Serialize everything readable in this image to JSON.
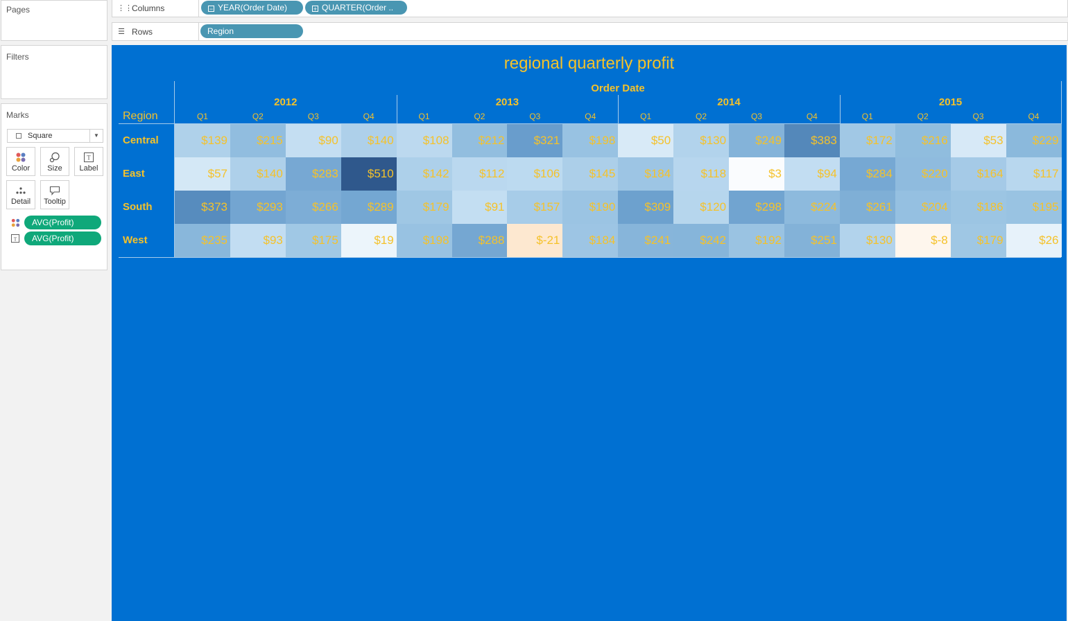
{
  "sidebar": {
    "pages_label": "Pages",
    "filters_label": "Filters",
    "marks_label": "Marks",
    "mark_type": "Square",
    "mark_buttons": [
      "Color",
      "Size",
      "Label",
      "Detail",
      "Tooltip"
    ],
    "mark_fields": [
      {
        "icon": "color-dots-icon",
        "label": "AVG(Profit)"
      },
      {
        "icon": "text-label-icon",
        "label": "AVG(Profit)"
      }
    ]
  },
  "shelves": {
    "columns_label": "Columns",
    "columns_pills": [
      "YEAR(Order Date)",
      "QUARTER(Order .."
    ],
    "rows_label": "Rows",
    "rows_pills": [
      "Region"
    ]
  },
  "colors": {
    "canvas": "#0070d2",
    "label_text": "#f5c22a",
    "pill_dimension": "#4996b2",
    "pill_measure": "#0fa87a"
  },
  "chart_data": {
    "type": "heatmap",
    "title": "regional quarterly profit",
    "column_header": "Order Date",
    "row_header": "Region",
    "years": [
      "2012",
      "2013",
      "2014",
      "2015"
    ],
    "quarters": [
      "Q1",
      "Q2",
      "Q3",
      "Q4"
    ],
    "rows": [
      "Central",
      "East",
      "South",
      "West"
    ],
    "values": [
      [
        139,
        215,
        90,
        140,
        108,
        212,
        321,
        198,
        50,
        130,
        249,
        383,
        172,
        216,
        53,
        229
      ],
      [
        57,
        140,
        283,
        510,
        142,
        112,
        106,
        145,
        184,
        118,
        3,
        94,
        284,
        220,
        164,
        117
      ],
      [
        373,
        293,
        266,
        289,
        179,
        91,
        157,
        190,
        309,
        120,
        298,
        224,
        261,
        204,
        186,
        195
      ],
      [
        235,
        93,
        175,
        19,
        198,
        288,
        -21,
        184,
        241,
        242,
        192,
        251,
        130,
        -8,
        179,
        26
      ]
    ],
    "value_format": "$",
    "color_scale": "diverging blue-orange, centered at 0"
  }
}
